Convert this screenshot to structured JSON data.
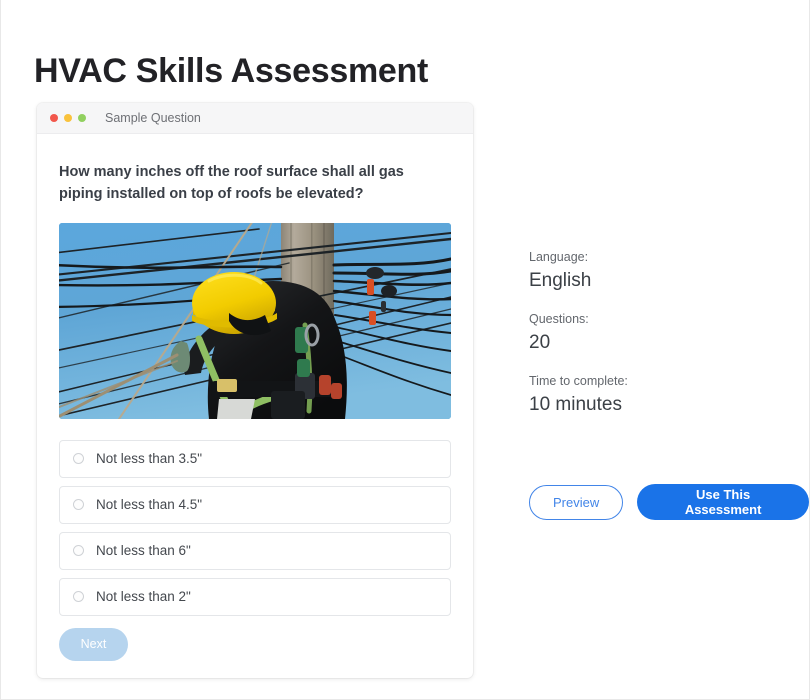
{
  "page": {
    "title": "HVAC Skills Assessment"
  },
  "card": {
    "header_title": "Sample Question",
    "traffic_lights": [
      "red-dot",
      "yellow-dot",
      "green-dot"
    ],
    "question": "How many inches off the roof surface shall all gas piping installed on top of roofs be elevated?",
    "image": {
      "name": "lineman-on-utility-pole-photo",
      "alt": "Utility worker in black jacket and yellow hard hat climbing a wooden utility pole with many wires against a blue sky"
    },
    "options": [
      {
        "label": "Not less than 3.5\"",
        "selected": false
      },
      {
        "label": "Not less than 4.5\"",
        "selected": false
      },
      {
        "label": "Not less than 6\"",
        "selected": false
      },
      {
        "label": "Not less than 2\"",
        "selected": false
      }
    ],
    "next_label": "Next"
  },
  "meta": {
    "groups": [
      {
        "label": "Language:",
        "value": "English"
      },
      {
        "label": "Questions:",
        "value": "20"
      },
      {
        "label": "Time to complete:",
        "value": "10 minutes"
      }
    ]
  },
  "actions": {
    "preview_label": "Preview",
    "use_label": "Use This Assessment"
  },
  "colors": {
    "primary_blue": "#1a73e8",
    "preview_border": "#4285e8",
    "next_disabled": "#b6d4ee",
    "dot_red": "#f2574c",
    "dot_yellow": "#f9c23c",
    "dot_green": "#91d05f",
    "title_text": "#222226",
    "body_text": "#44484e",
    "muted_text": "#63676d",
    "card_header_bg": "#f6f6f7",
    "option_border": "#e4e6e9"
  }
}
